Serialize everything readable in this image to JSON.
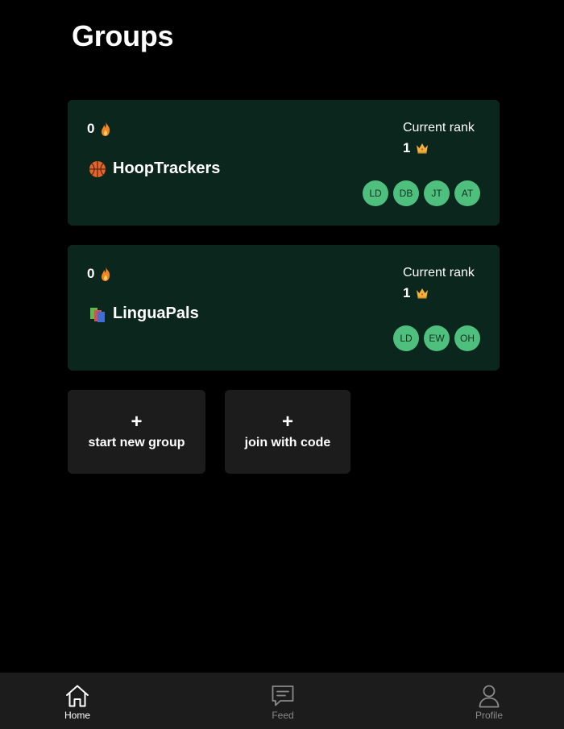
{
  "page": {
    "title": "Groups"
  },
  "groups": [
    {
      "streak": "0",
      "name": "HoopTrackers",
      "icon": "basketball-icon",
      "rank_label": "Current rank",
      "rank": "1",
      "members": [
        "LD",
        "DB",
        "JT",
        "AT"
      ]
    },
    {
      "streak": "0",
      "name": "LinguaPals",
      "icon": "books-icon",
      "rank_label": "Current rank",
      "rank": "1",
      "members": [
        "LD",
        "EW",
        "OH"
      ]
    }
  ],
  "actions": {
    "new_group": {
      "plus": "+",
      "label": "start new group"
    },
    "join_code": {
      "plus": "+",
      "label": "join with code"
    }
  },
  "tabbar": {
    "home": {
      "label": "Home",
      "icon": "home-icon"
    },
    "feed": {
      "label": "Feed",
      "icon": "chat-icon"
    },
    "profile": {
      "label": "Profile",
      "icon": "person-icon"
    }
  },
  "colors": {
    "background": "#000000",
    "card": "#0b261c",
    "button": "#1c1c1c",
    "avatar": "#4fbf7e",
    "flame": "#f5861f",
    "crown": "#f2b33d"
  }
}
